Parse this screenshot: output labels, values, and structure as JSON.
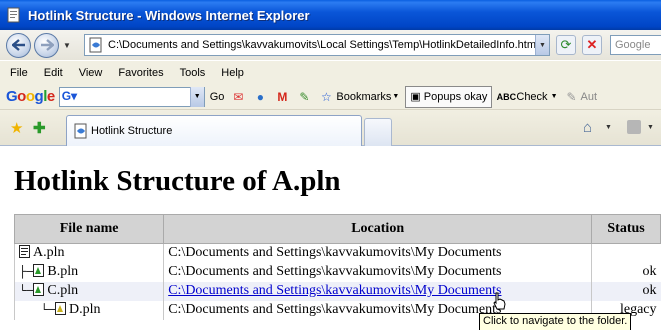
{
  "window": {
    "title": "Hotlink Structure - Windows Internet Explorer"
  },
  "address": {
    "url": "C:\\Documents and Settings\\kavvakumovits\\Local Settings\\Temp\\HotlinkDetailedInfo.htm",
    "search_placeholder": "Google"
  },
  "menu": [
    "File",
    "Edit",
    "View",
    "Favorites",
    "Tools",
    "Help"
  ],
  "google_toolbar": {
    "logo": "Google",
    "go_label": "Go",
    "bookmarks_label": "Bookmarks",
    "popups_label": "Popups okay",
    "check_label": "Check",
    "autofill_label": "Aut"
  },
  "tab": {
    "label": "Hotlink Structure"
  },
  "page": {
    "heading": "Hotlink Structure of A.pln",
    "columns": [
      "File name",
      "Location",
      "Status"
    ],
    "rows": [
      {
        "tree": "",
        "file": "A.pln",
        "location": "C:\\Documents and Settings\\kavvakumovits\\My Documents",
        "status": "",
        "link": false,
        "file_icon": "document-icon"
      },
      {
        "tree": "├─",
        "file": "B.pln",
        "location": "C:\\Documents and Settings\\kavvakumovits\\My Documents",
        "status": "ok",
        "link": false,
        "file_icon": "hotlink-file-icon"
      },
      {
        "tree": "└─",
        "file": "C.pln",
        "location": "C:\\Documents and Settings\\kavvakumovits\\My Documents",
        "status": "ok",
        "link": true,
        "file_icon": "hotlink-file-icon"
      },
      {
        "tree": "   └─",
        "file": "D.pln",
        "location": "C:\\Documents and Settings\\kavvakumovits\\My Documents",
        "status": "legacy",
        "link": false,
        "file_icon": "legacy-file-icon"
      }
    ],
    "tooltip": "Click to navigate to the folder."
  },
  "colors": {
    "titlebar": "#0a56d8",
    "link": "#0000cc",
    "header_bg": "#d3d3d3",
    "highlight_row": "#eef0f8",
    "tooltip_bg": "#ffffe1"
  }
}
